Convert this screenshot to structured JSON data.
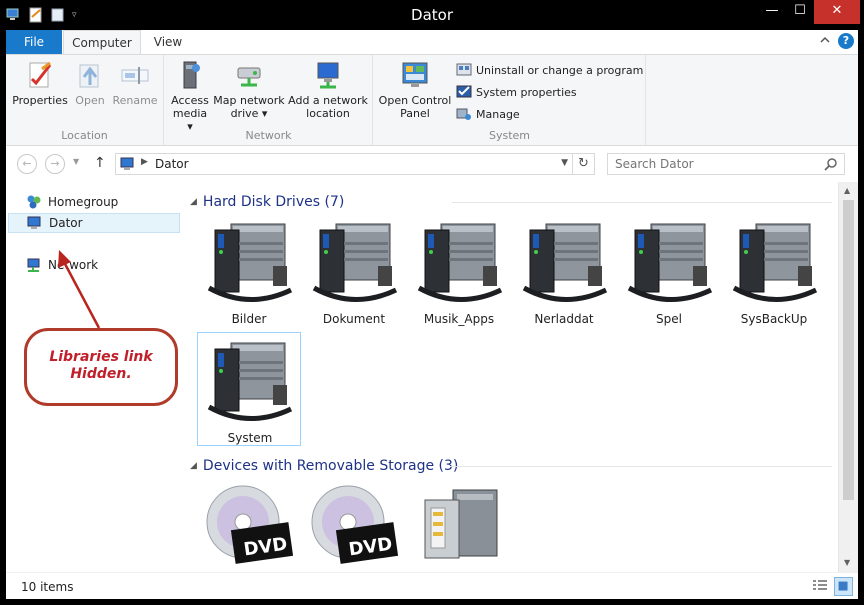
{
  "window": {
    "title": "Dator"
  },
  "window_controls": {
    "minimize": "—",
    "maximize": "☐",
    "close": "✕"
  },
  "tabs": [
    {
      "label": "File"
    },
    {
      "label": "Computer"
    },
    {
      "label": "View"
    }
  ],
  "ribbon": {
    "location": {
      "label": "Location",
      "buttons": [
        {
          "label": "Properties"
        },
        {
          "label": "Open"
        },
        {
          "label": "Rename"
        }
      ]
    },
    "network": {
      "label": "Network",
      "buttons": [
        {
          "label_line1": "Access",
          "label_line2": "media ▾"
        },
        {
          "label_line1": "Map network",
          "label_line2": "drive ▾"
        },
        {
          "label_line1": "Add a network",
          "label_line2": "location"
        }
      ]
    },
    "system": {
      "label": "System",
      "open_control_panel_line1": "Open Control",
      "open_control_panel_line2": "Panel",
      "small_buttons": [
        {
          "label": "Uninstall or change a program"
        },
        {
          "label": "System properties"
        },
        {
          "label": "Manage"
        }
      ]
    }
  },
  "address": {
    "path": "Dator",
    "search_placeholder": "Search Dator"
  },
  "nav_pane": {
    "items": [
      {
        "label": "Homegroup"
      },
      {
        "label": "Dator"
      },
      {
        "label": "Network"
      }
    ]
  },
  "callout": {
    "line1": "Libraries link",
    "line2": "Hidden."
  },
  "content": {
    "hard_disk_group": {
      "title": "Hard Disk Drives (7)",
      "items": [
        {
          "label": "Bilder"
        },
        {
          "label": "Dokument"
        },
        {
          "label": "Musik_Apps"
        },
        {
          "label": "Nerladdat"
        },
        {
          "label": "Spel"
        },
        {
          "label": "SysBackUp"
        },
        {
          "label": "System"
        }
      ]
    },
    "removable_group": {
      "title": "Devices with Removable Storage (3)",
      "items": [
        {
          "label": ""
        },
        {
          "label": ""
        },
        {
          "label": ""
        }
      ]
    }
  },
  "statusbar": {
    "text": "10 items"
  },
  "colors": {
    "accent": "#1979ca",
    "group_header": "#1e3287",
    "close_button": "#c7312c",
    "callout_border": "#b13b2a",
    "callout_text": "#c0202a"
  }
}
